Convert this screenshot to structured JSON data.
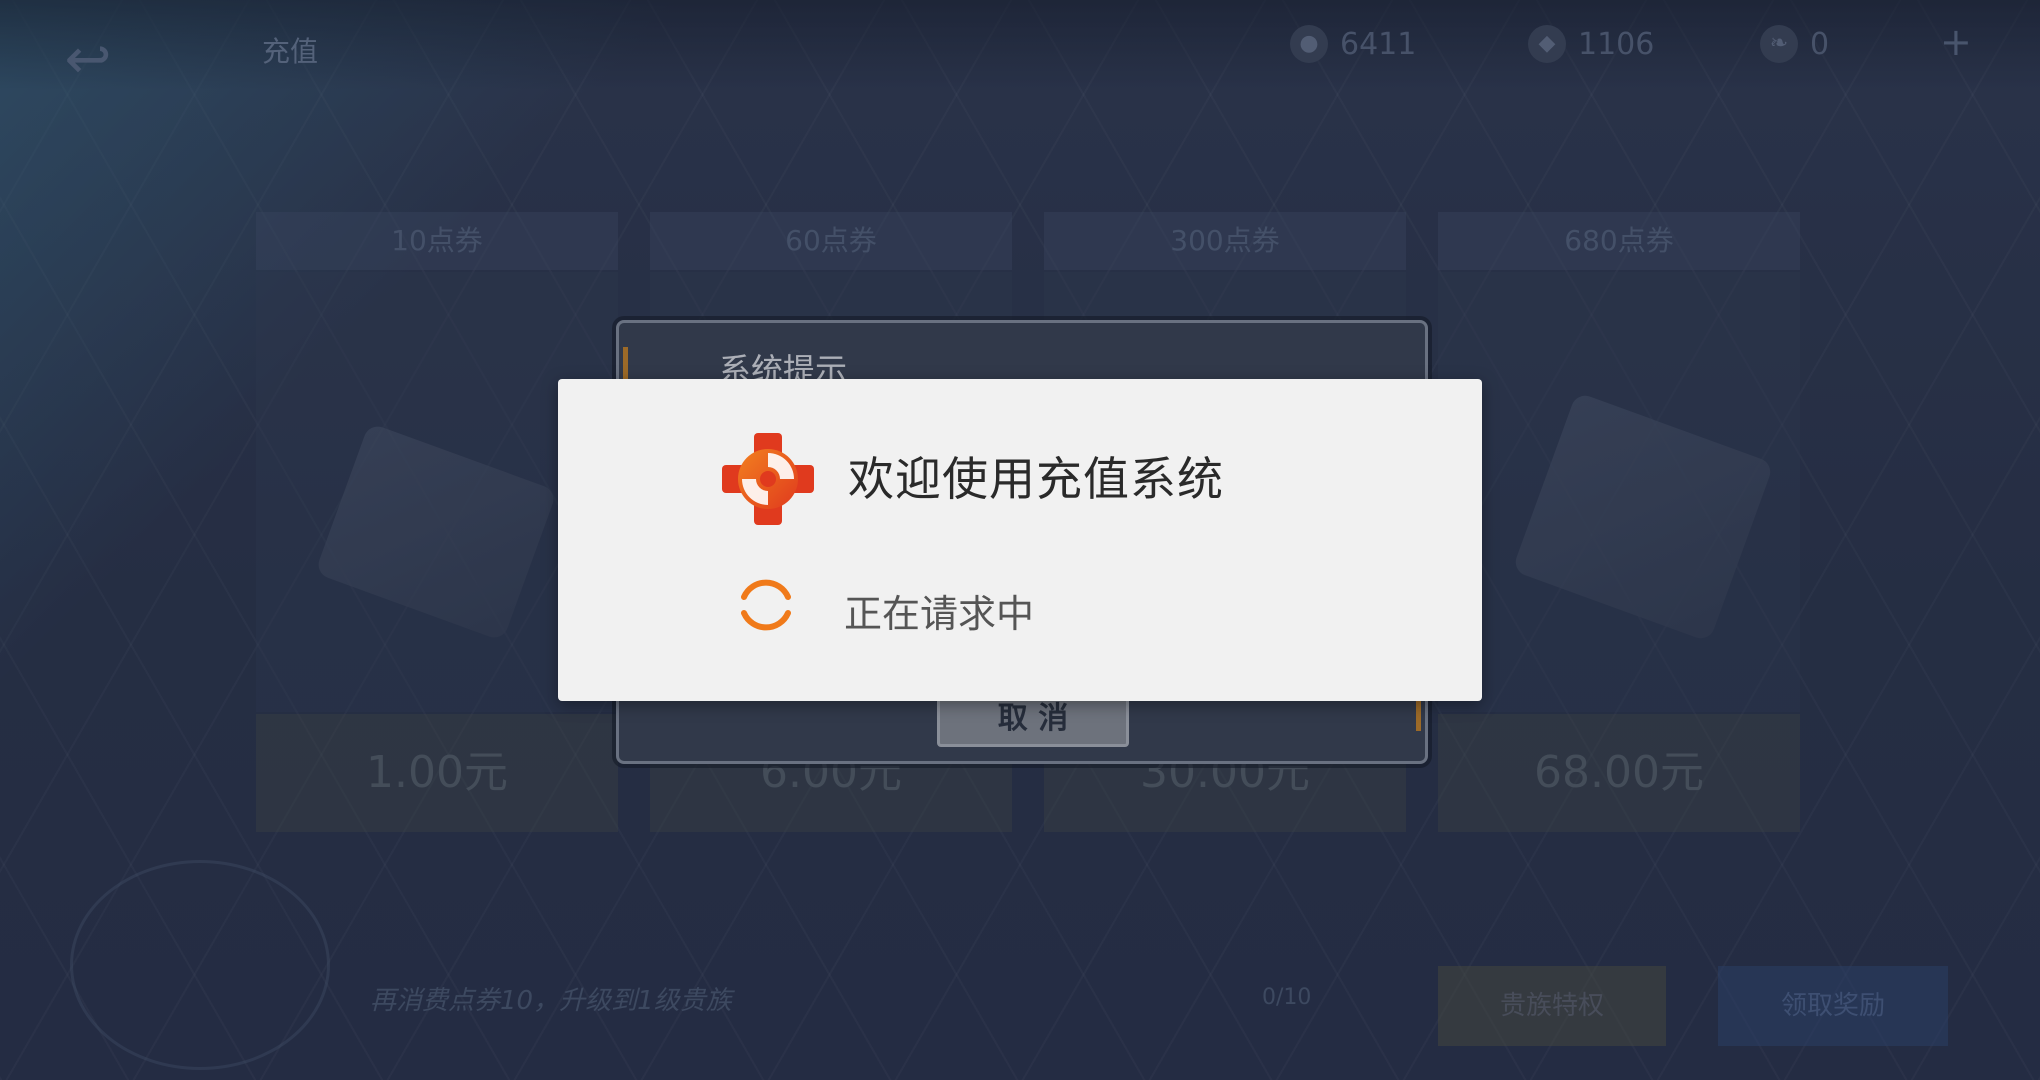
{
  "header": {
    "title": "充值",
    "currencies": [
      {
        "icon": "coin-icon",
        "value": "6411"
      },
      {
        "icon": "gem-icon",
        "value": "1106"
      },
      {
        "icon": "leaf-icon",
        "value": "0"
      }
    ],
    "plus": "+"
  },
  "tiers": [
    {
      "label": "10点券",
      "price": "1.00元"
    },
    {
      "label": "60点券",
      "price": "6.00元"
    },
    {
      "label": "300点券",
      "price": "30.00元"
    },
    {
      "label": "680点券",
      "price": "68.00元"
    }
  ],
  "footer": {
    "progress_text": "再消费点券10，升级到1级贵族",
    "count": "0/10",
    "button_1": "贵族特权",
    "button_2": "领取奖励"
  },
  "system_dialog": {
    "title": "系统提示",
    "cancel_label": "取 消"
  },
  "payment_dialog": {
    "title": "欢迎使用充值系统",
    "status": "正在请求中",
    "logo_colors": [
      "#e03a1e",
      "#f2801f"
    ],
    "spinner_color": "#f07a1a"
  }
}
